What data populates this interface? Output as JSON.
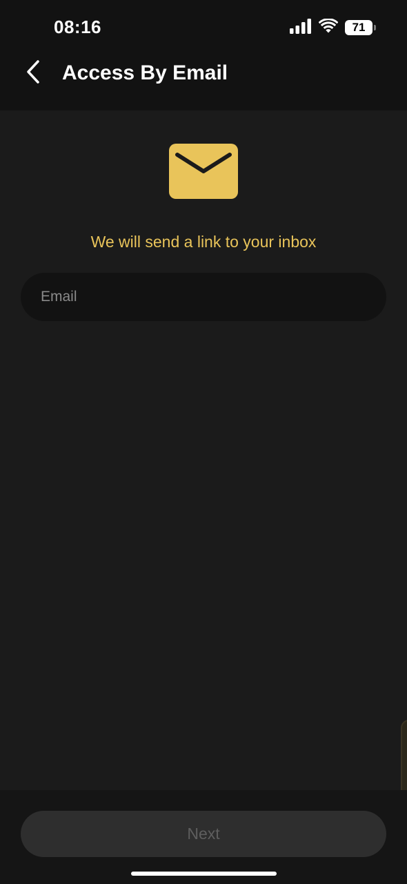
{
  "status_bar": {
    "time": "08:16",
    "battery_level": "71",
    "signal_icon": "cellular-signal-icon",
    "wifi_icon": "wifi-icon"
  },
  "header": {
    "back_icon": "chevron-left-icon",
    "title": "Access By Email"
  },
  "main": {
    "icon": "envelope-icon",
    "icon_color": "#e9c45a",
    "subtitle": "We will send a link to your inbox",
    "email_input": {
      "placeholder": "Email",
      "value": ""
    }
  },
  "footer": {
    "next_label": "Next"
  },
  "colors": {
    "accent": "#e9c45a",
    "background": "#1b1b1b",
    "header_background": "#121212",
    "button_disabled": "#2e2e2e"
  }
}
